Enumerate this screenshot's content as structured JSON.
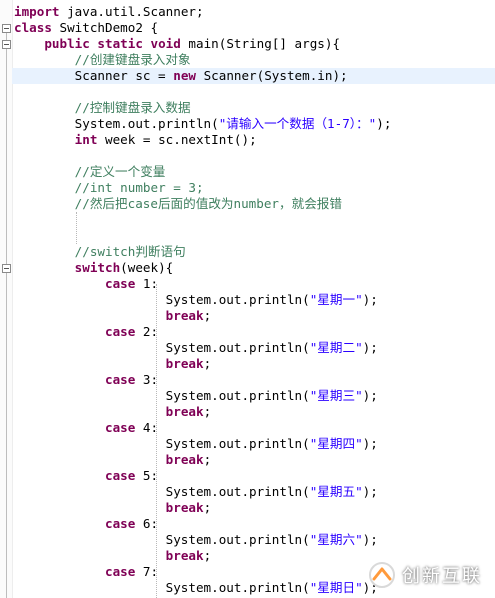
{
  "lines": [
    {
      "parts": [
        {
          "t": "import",
          "c": "kw"
        },
        {
          "t": " java.util.Scanner;",
          "c": ""
        }
      ]
    },
    {
      "parts": [
        {
          "t": "class",
          "c": "kw"
        },
        {
          "t": " SwitchDemo2 {",
          "c": ""
        }
      ]
    },
    {
      "parts": [
        {
          "t": "    ",
          "c": ""
        },
        {
          "t": "public static void",
          "c": "kw"
        },
        {
          "t": " main(String[] args){",
          "c": ""
        }
      ]
    },
    {
      "parts": [
        {
          "t": "        ",
          "c": ""
        },
        {
          "t": "//创建键盘录入对象",
          "c": "cmt"
        }
      ]
    },
    {
      "parts": [
        {
          "t": "        Scanner sc = ",
          "c": ""
        },
        {
          "t": "new",
          "c": "kw"
        },
        {
          "t": " Scanner(System.in);",
          "c": ""
        }
      ]
    },
    {
      "parts": []
    },
    {
      "parts": [
        {
          "t": "        ",
          "c": ""
        },
        {
          "t": "//控制键盘录入数据",
          "c": "cmt"
        }
      ]
    },
    {
      "parts": [
        {
          "t": "        System.out.println(",
          "c": ""
        },
        {
          "t": "\"请输入一个数据（1-7）：\"",
          "c": "str"
        },
        {
          "t": ");",
          "c": ""
        }
      ]
    },
    {
      "parts": [
        {
          "t": "        ",
          "c": ""
        },
        {
          "t": "int",
          "c": "kw"
        },
        {
          "t": " week = sc.nextInt();",
          "c": ""
        }
      ]
    },
    {
      "parts": []
    },
    {
      "parts": [
        {
          "t": "        ",
          "c": ""
        },
        {
          "t": "//定义一个变量",
          "c": "cmt"
        }
      ]
    },
    {
      "parts": [
        {
          "t": "        ",
          "c": ""
        },
        {
          "t": "//int number = 3;",
          "c": "cmt"
        }
      ]
    },
    {
      "parts": [
        {
          "t": "        ",
          "c": ""
        },
        {
          "t": "//然后把case后面的值改为number，就会报错",
          "c": "cmt"
        }
      ]
    },
    {
      "parts": []
    },
    {
      "parts": []
    },
    {
      "parts": [
        {
          "t": "        ",
          "c": ""
        },
        {
          "t": "//switch判断语句",
          "c": "cmt"
        }
      ]
    },
    {
      "parts": [
        {
          "t": "        ",
          "c": ""
        },
        {
          "t": "switch",
          "c": "kw"
        },
        {
          "t": "(week){",
          "c": ""
        }
      ]
    },
    {
      "parts": [
        {
          "t": "            ",
          "c": ""
        },
        {
          "t": "case",
          "c": "kw"
        },
        {
          "t": " 1:",
          "c": ""
        }
      ]
    },
    {
      "parts": [
        {
          "t": "                    System.out.println(",
          "c": ""
        },
        {
          "t": "\"星期一\"",
          "c": "str"
        },
        {
          "t": ");",
          "c": ""
        }
      ]
    },
    {
      "parts": [
        {
          "t": "                    ",
          "c": ""
        },
        {
          "t": "break",
          "c": "kw"
        },
        {
          "t": ";",
          "c": ""
        }
      ]
    },
    {
      "parts": [
        {
          "t": "            ",
          "c": ""
        },
        {
          "t": "case",
          "c": "kw"
        },
        {
          "t": " 2:",
          "c": ""
        }
      ]
    },
    {
      "parts": [
        {
          "t": "                    System.out.println(",
          "c": ""
        },
        {
          "t": "\"星期二\"",
          "c": "str"
        },
        {
          "t": ");",
          "c": ""
        }
      ]
    },
    {
      "parts": [
        {
          "t": "                    ",
          "c": ""
        },
        {
          "t": "break",
          "c": "kw"
        },
        {
          "t": ";",
          "c": ""
        }
      ]
    },
    {
      "parts": [
        {
          "t": "            ",
          "c": ""
        },
        {
          "t": "case",
          "c": "kw"
        },
        {
          "t": " 3:",
          "c": ""
        }
      ]
    },
    {
      "parts": [
        {
          "t": "                    System.out.println(",
          "c": ""
        },
        {
          "t": "\"星期三\"",
          "c": "str"
        },
        {
          "t": ");",
          "c": ""
        }
      ]
    },
    {
      "parts": [
        {
          "t": "                    ",
          "c": ""
        },
        {
          "t": "break",
          "c": "kw"
        },
        {
          "t": ";",
          "c": ""
        }
      ]
    },
    {
      "parts": [
        {
          "t": "            ",
          "c": ""
        },
        {
          "t": "case",
          "c": "kw"
        },
        {
          "t": " 4:",
          "c": ""
        }
      ]
    },
    {
      "parts": [
        {
          "t": "                    System.out.println(",
          "c": ""
        },
        {
          "t": "\"星期四\"",
          "c": "str"
        },
        {
          "t": ");",
          "c": ""
        }
      ]
    },
    {
      "parts": [
        {
          "t": "                    ",
          "c": ""
        },
        {
          "t": "break",
          "c": "kw"
        },
        {
          "t": ";",
          "c": ""
        }
      ]
    },
    {
      "parts": [
        {
          "t": "            ",
          "c": ""
        },
        {
          "t": "case",
          "c": "kw"
        },
        {
          "t": " 5:",
          "c": ""
        }
      ]
    },
    {
      "parts": [
        {
          "t": "                    System.out.println(",
          "c": ""
        },
        {
          "t": "\"星期五\"",
          "c": "str"
        },
        {
          "t": ");",
          "c": ""
        }
      ]
    },
    {
      "parts": [
        {
          "t": "                    ",
          "c": ""
        },
        {
          "t": "break",
          "c": "kw"
        },
        {
          "t": ";",
          "c": ""
        }
      ]
    },
    {
      "parts": [
        {
          "t": "            ",
          "c": ""
        },
        {
          "t": "case",
          "c": "kw"
        },
        {
          "t": " 6:",
          "c": ""
        }
      ]
    },
    {
      "parts": [
        {
          "t": "                    System.out.println(",
          "c": ""
        },
        {
          "t": "\"星期六\"",
          "c": "str"
        },
        {
          "t": ");",
          "c": ""
        }
      ]
    },
    {
      "parts": [
        {
          "t": "                    ",
          "c": ""
        },
        {
          "t": "break",
          "c": "kw"
        },
        {
          "t": ";",
          "c": ""
        }
      ]
    },
    {
      "parts": [
        {
          "t": "            ",
          "c": ""
        },
        {
          "t": "case",
          "c": "kw"
        },
        {
          "t": " 7:",
          "c": ""
        }
      ]
    },
    {
      "parts": [
        {
          "t": "                    System.out.println(",
          "c": ""
        },
        {
          "t": "\"星期日\"",
          "c": "str"
        },
        {
          "t": ");",
          "c": ""
        }
      ]
    }
  ],
  "highlighted_line": 4,
  "fold_markers": [
    1,
    2,
    16
  ],
  "colors": {
    "keyword": "#7f0055",
    "comment": "#3f7f5f",
    "string": "#2a00ff",
    "line_highlight": "#e8f2fe"
  },
  "watermark": {
    "text": "创新互联",
    "icon": "brand-logo-icon"
  }
}
